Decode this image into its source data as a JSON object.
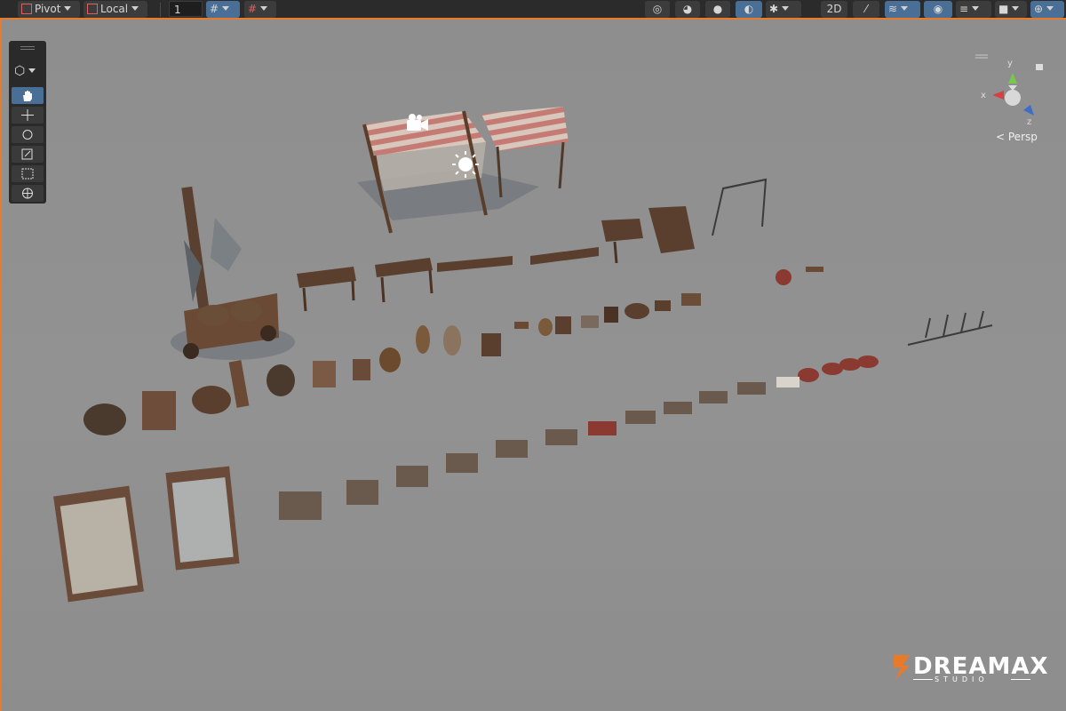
{
  "toolbar": {
    "pivot_label": "Pivot",
    "local_label": "Local",
    "grid_value": "1"
  },
  "viewport": {
    "projection_label": "Persp",
    "axis_x": "x",
    "axis_y": "y",
    "axis_z": "z"
  },
  "watermark": {
    "brand": "DREAMAX",
    "sub": "STUDIO"
  },
  "colors": {
    "accent": "#e87a2a",
    "active_tool": "#4a6f97",
    "toolbar_bg": "#2b2b2b",
    "viewport_bg": "#8f8f8f"
  },
  "icons": {
    "tools": [
      "hand-icon",
      "move-icon",
      "rotate-icon",
      "scale-icon",
      "rect-transform-icon",
      "transform-icon"
    ],
    "scene_overlays": [
      "camera-icon",
      "light-sun-icon"
    ]
  }
}
